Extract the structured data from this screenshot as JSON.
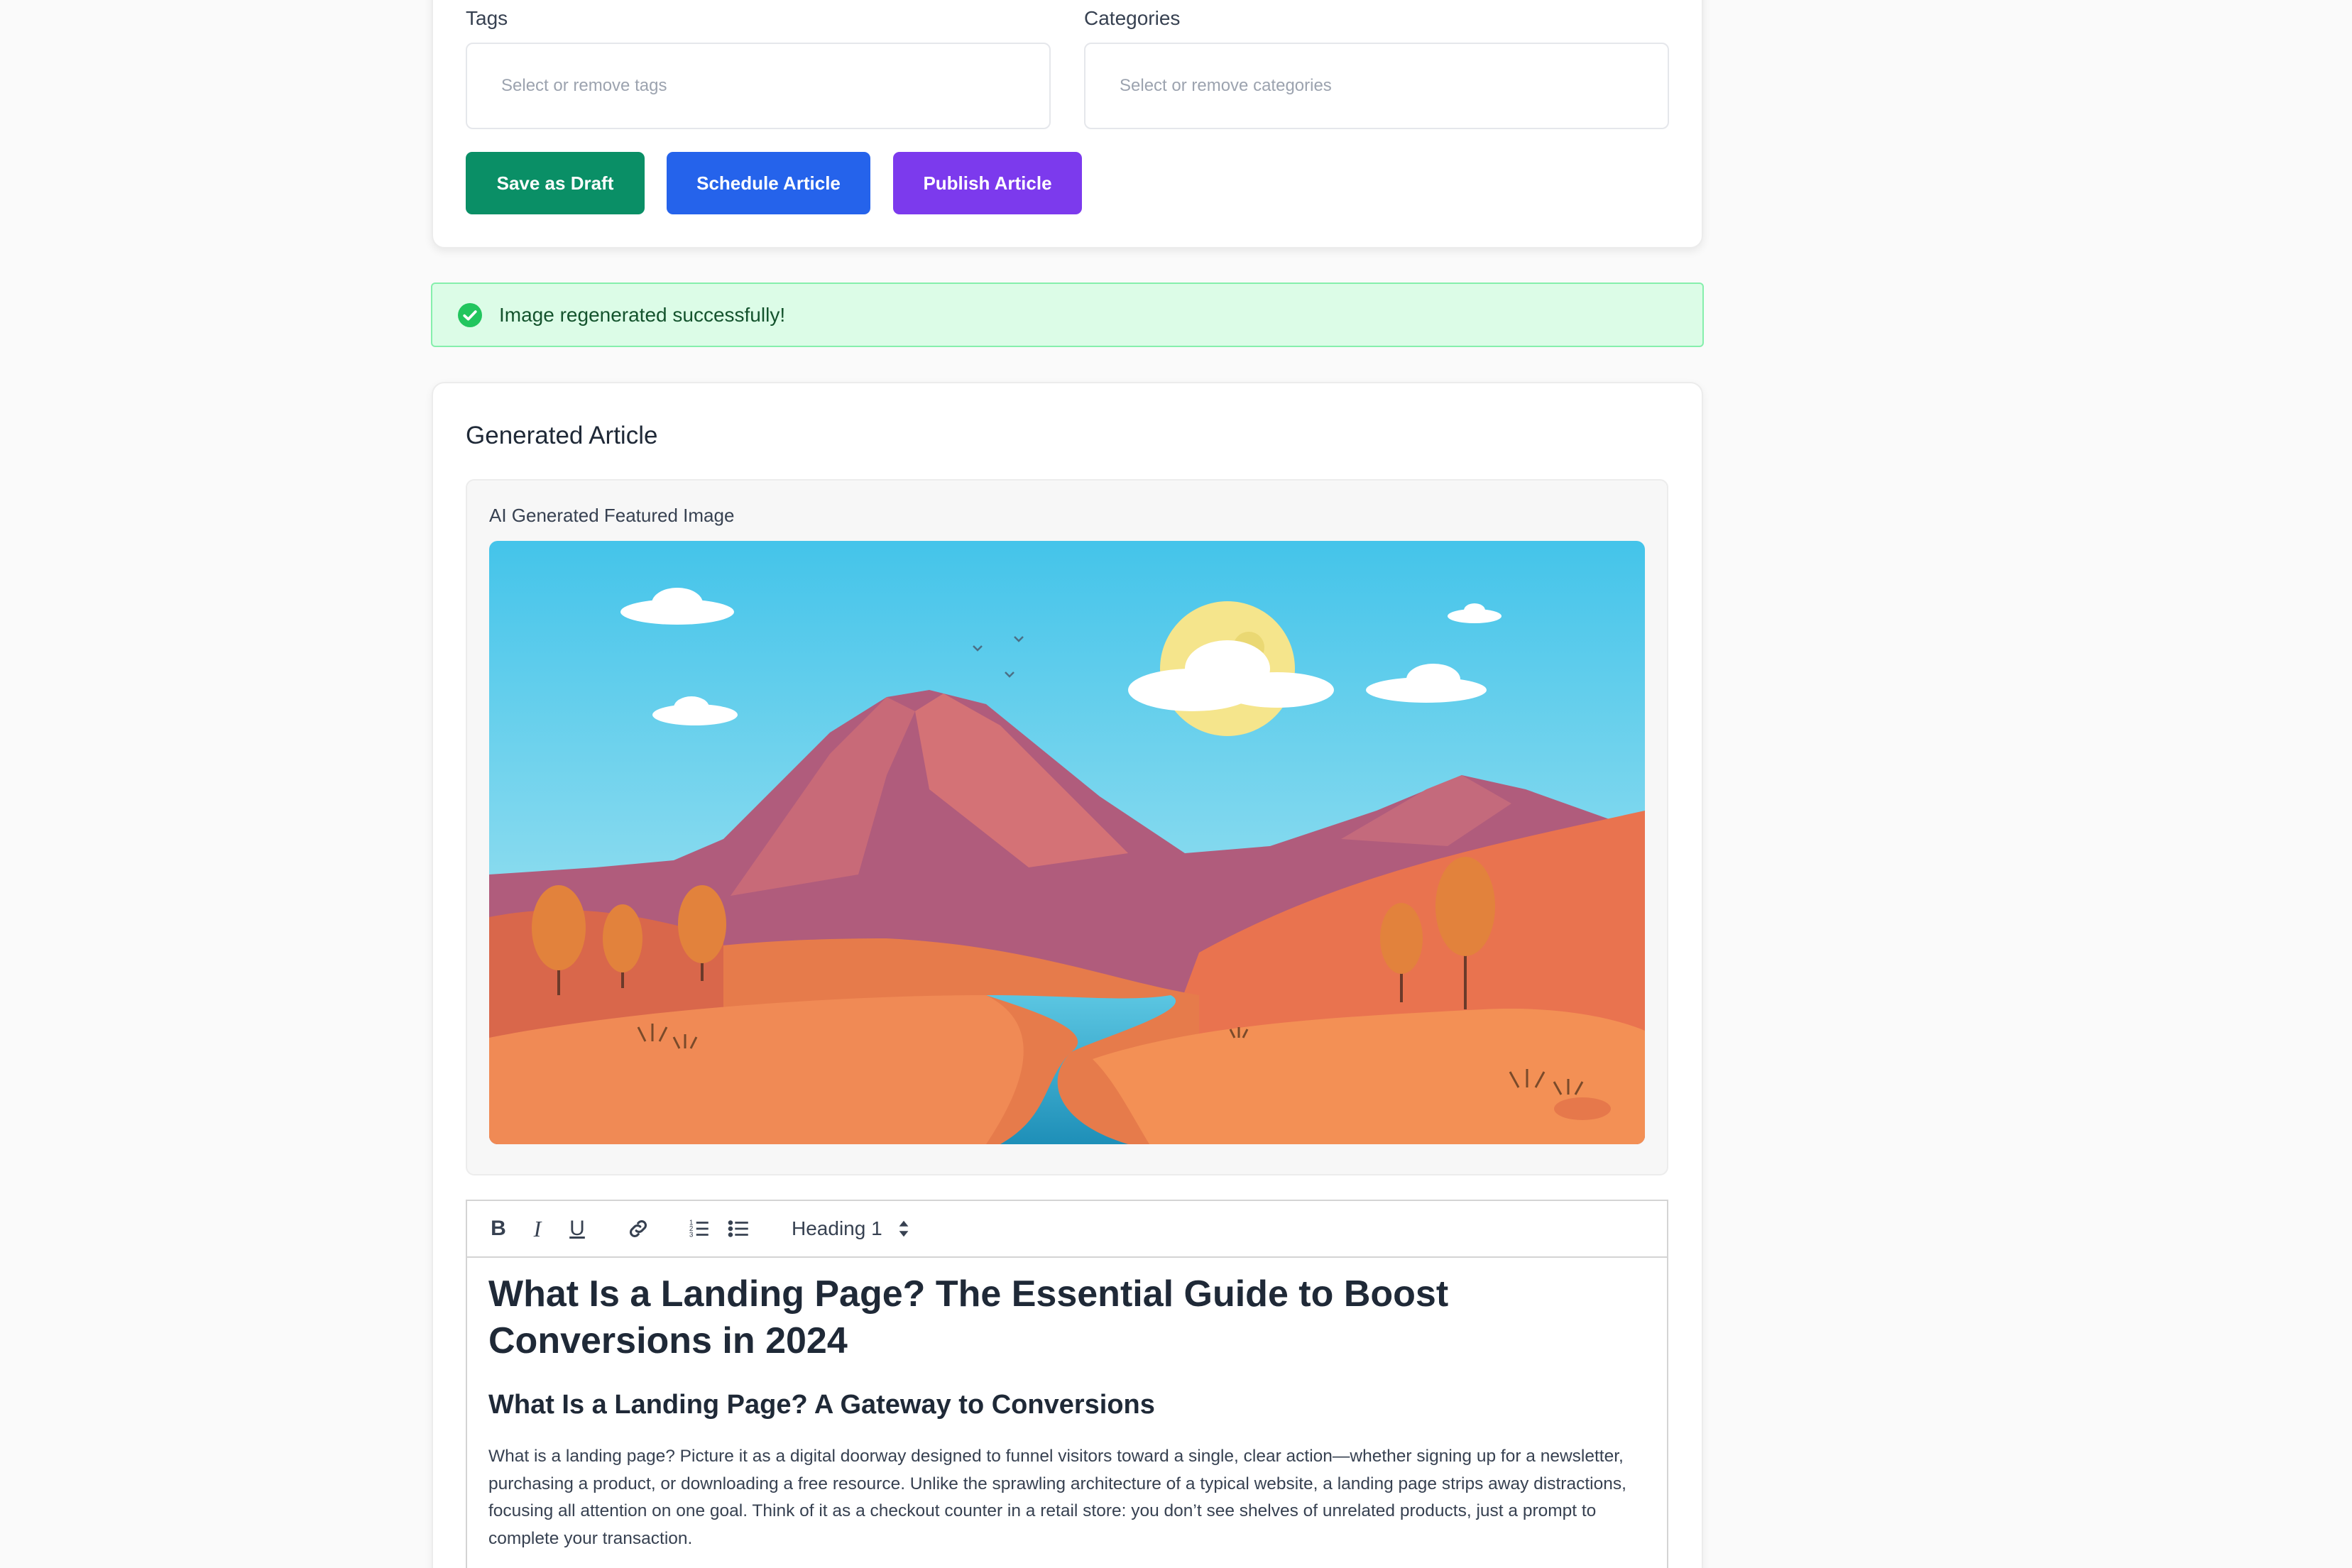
{
  "form": {
    "tags_label": "Tags",
    "tags_placeholder": "Select or remove tags",
    "categories_label": "Categories",
    "categories_placeholder": "Select or remove categories",
    "save_draft_label": "Save as Draft",
    "schedule_label": "Schedule Article",
    "publish_label": "Publish Article"
  },
  "alert": {
    "message": "Image regenerated successfully!",
    "icon": "check-circle-icon"
  },
  "article": {
    "card_title": "Generated Article",
    "image_label": "AI Generated Featured Image",
    "toolbar": {
      "bold": "B",
      "italic": "I",
      "underline": "U",
      "heading_select": "Heading 1",
      "icons": [
        "bold-icon",
        "italic-icon",
        "underline-icon",
        "link-icon",
        "ordered-list-icon",
        "bullet-list-icon",
        "select-arrows-icon"
      ]
    },
    "h1": "What Is a Landing Page? The Essential Guide to Boost Conversions in 2024",
    "h2": "What Is a Landing Page? A Gateway to Conversions",
    "paragraph": "What is a landing page? Picture it as a digital doorway designed to funnel visitors toward a single, clear action—whether signing up for a newsletter, purchasing a product, or downloading a free resource. Unlike the sprawling architecture of a typical website, a landing page strips away distractions, focusing all attention on one goal. Think of it as a checkout counter in a retail store: you don’t see shelves of unrelated products, just a prompt to complete your transaction."
  },
  "colors": {
    "draft": "#0a8f66",
    "schedule": "#2563eb",
    "publish": "#7c3aed",
    "alert_bg": "#dcfce7",
    "alert_icon": "#22c55e"
  }
}
